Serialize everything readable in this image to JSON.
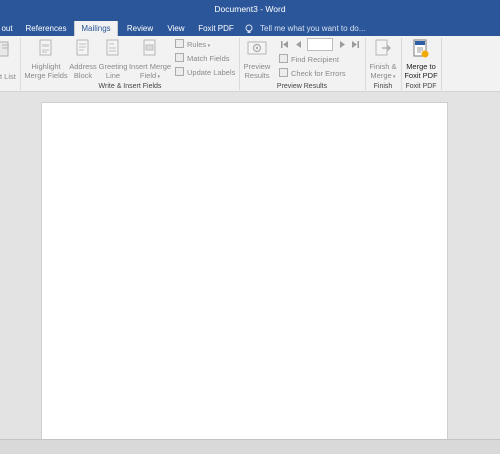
{
  "window": {
    "title": "Document3 - Word"
  },
  "tabs": {
    "layout": "out",
    "references": "References",
    "mailings": "Mailings",
    "review": "Review",
    "view": "View",
    "foxit": "Foxit PDF",
    "tell_me": "Tell me what you want to do..."
  },
  "ribbon": {
    "recipient_list": "t List",
    "highlight_line1": "Highlight",
    "highlight_line2": "Merge Fields",
    "address_line1": "Address",
    "address_line2": "Block",
    "greeting_line1": "Greeting",
    "greeting_line2": "Line",
    "insert_line1": "Insert Merge",
    "insert_line2": "Field",
    "rules": "Rules",
    "match_fields": "Match Fields",
    "update_labels": "Update Labels",
    "write_insert_group": "Write & Insert Fields",
    "preview_line1": "Preview",
    "preview_line2": "Results",
    "find_recipient": "Find Recipient",
    "check_errors": "Check for Errors",
    "preview_group": "Preview Results",
    "finish_line1": "Finish &",
    "finish_line2": "Merge",
    "finish_group": "Finish",
    "foxit_line1": "Merge to",
    "foxit_line2": "Foxit PDF",
    "foxit_group": "Foxit PDF"
  }
}
